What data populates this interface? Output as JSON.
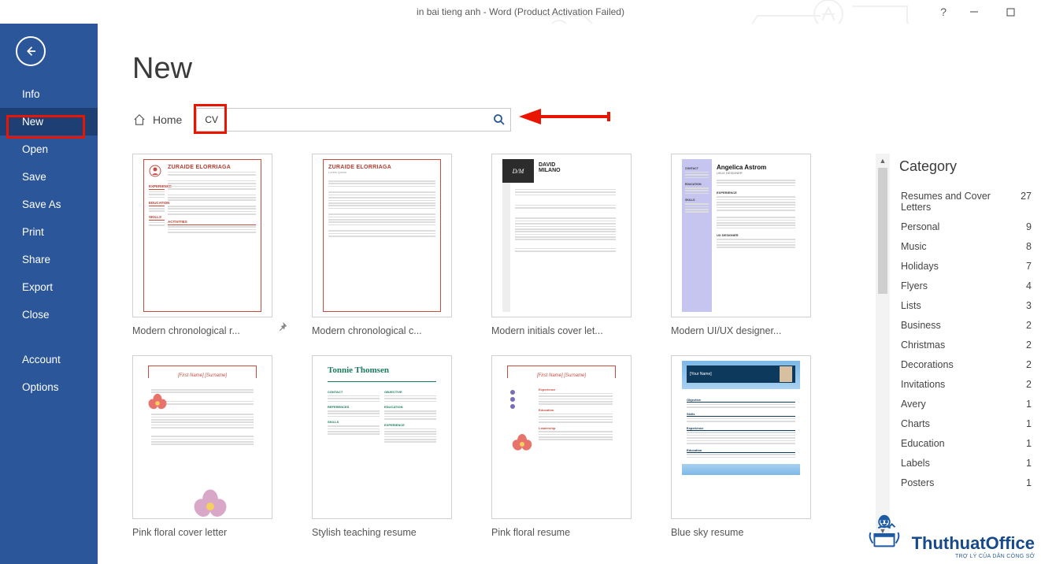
{
  "titlebar": {
    "title": "in bai tieng anh - Word (Product Activation Failed)"
  },
  "sidebar": {
    "items": [
      {
        "label": "Info"
      },
      {
        "label": "New",
        "selected": true
      },
      {
        "label": "Open"
      },
      {
        "label": "Save"
      },
      {
        "label": "Save As"
      },
      {
        "label": "Print"
      },
      {
        "label": "Share"
      },
      {
        "label": "Export"
      },
      {
        "label": "Close"
      }
    ],
    "footer": [
      {
        "label": "Account"
      },
      {
        "label": "Options"
      }
    ]
  },
  "main": {
    "title": "New",
    "home_label": "Home",
    "search_value": "CV"
  },
  "templates": [
    {
      "label": "Modern chronological r...",
      "selected": true,
      "style": "zuraide"
    },
    {
      "label": "Modern chronological c...",
      "style": "zuraide2"
    },
    {
      "label": "Modern initials cover let...",
      "style": "dm"
    },
    {
      "label": "Modern UI/UX designer...",
      "style": "purple"
    },
    {
      "label": "Pink floral cover letter",
      "style": "floral"
    },
    {
      "label": "Stylish teaching resume",
      "style": "green"
    },
    {
      "label": "Pink floral resume",
      "style": "floral2"
    },
    {
      "label": "Blue sky resume",
      "style": "sky"
    }
  ],
  "thumb_text": {
    "zuraide_name": "ZURAIDE ELORRIAGA",
    "dm_initials": "D/M",
    "dm_name": "DAVID MILANO",
    "purple_name": "Angelica Astrom",
    "purple_role": "UI/UX DESIGNER",
    "floral_name": "[First Name] [Surname]",
    "green_name": "Tonnie Thomsen",
    "sky_name": "[Your Name]"
  },
  "category": {
    "title": "Category",
    "items": [
      {
        "label": "Resumes and Cover Letters",
        "count": 27
      },
      {
        "label": "Personal",
        "count": 9
      },
      {
        "label": "Music",
        "count": 8
      },
      {
        "label": "Holidays",
        "count": 7
      },
      {
        "label": "Flyers",
        "count": 4
      },
      {
        "label": "Lists",
        "count": 3
      },
      {
        "label": "Business",
        "count": 2
      },
      {
        "label": "Christmas",
        "count": 2
      },
      {
        "label": "Decorations",
        "count": 2
      },
      {
        "label": "Invitations",
        "count": 2
      },
      {
        "label": "Avery",
        "count": 1
      },
      {
        "label": "Charts",
        "count": 1
      },
      {
        "label": "Education",
        "count": 1
      },
      {
        "label": "Labels",
        "count": 1
      },
      {
        "label": "Posters",
        "count": 1
      }
    ]
  },
  "watermark": {
    "big": "ThuthuatOffice",
    "sub": "TRỢ LÝ CỦA DÂN CÔNG SỞ"
  }
}
